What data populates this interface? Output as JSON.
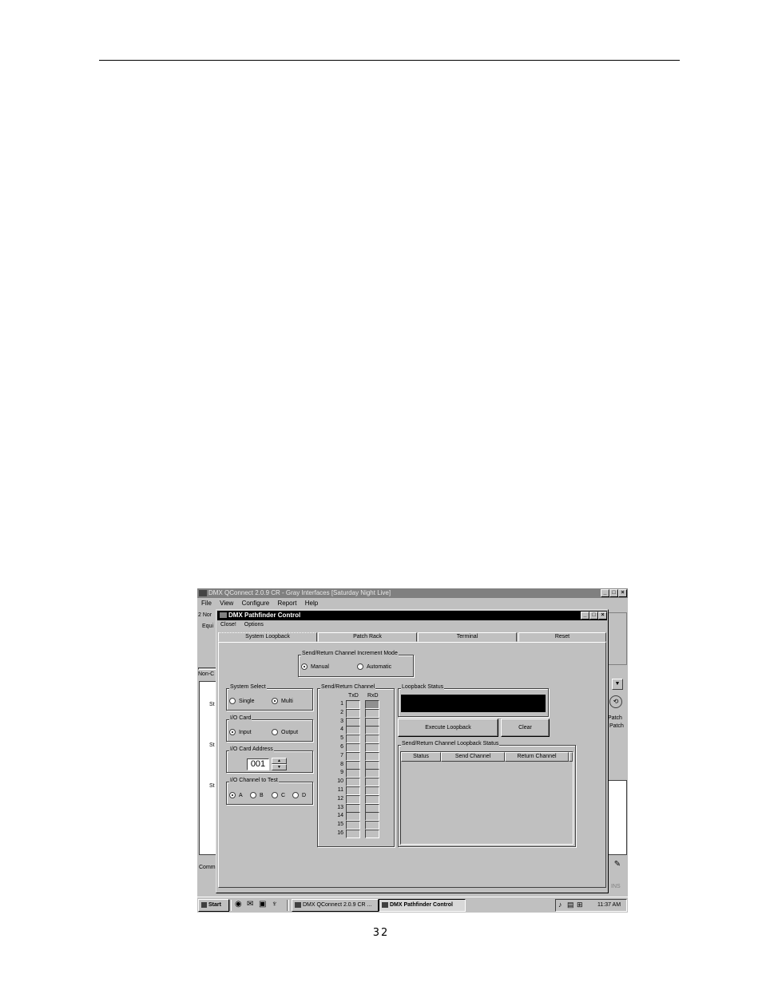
{
  "page": {
    "page_number": "32"
  },
  "main_window": {
    "title": "DMX QConnect 2.0.9 CR - Gray Interfaces [Saturday Night Live]",
    "menu": [
      "File",
      "View",
      "Configure",
      "Report",
      "Help"
    ],
    "left_fragments": [
      "2 Nor",
      "Equi",
      "Non-C",
      "St",
      "St",
      "St",
      "Comm"
    ],
    "right_fragments": [
      "Patch",
      "Patch"
    ],
    "status_fragment": "INS"
  },
  "dialog": {
    "title": "DMX Pathfinder Control",
    "menu": [
      "Close!",
      "Options"
    ],
    "tabs": [
      "System Loopback",
      "Patch Rack",
      "Terminal",
      "Reset"
    ],
    "increment_mode": {
      "label": "Send/Return Channel Increment Mode",
      "options": [
        "Manual",
        "Automatic"
      ],
      "selected": "Manual"
    },
    "system_select": {
      "label": "System Select",
      "options": [
        "Single",
        "Multi"
      ],
      "selected": "Multi"
    },
    "io_card": {
      "label": "I/O Card",
      "options": [
        "Input",
        "Output"
      ],
      "selected": "Input"
    },
    "io_card_address": {
      "label": "I/O Card Address",
      "value": "001"
    },
    "io_channel": {
      "label": "I/O Channel to Test",
      "options": [
        "A",
        "B",
        "C",
        "D"
      ],
      "selected": "A"
    },
    "channel_grid": {
      "label": "Send/Return Channel",
      "col_txd": "TxD",
      "col_rxd": "RxD",
      "rows": [
        "1",
        "2",
        "3",
        "4",
        "5",
        "6",
        "7",
        "8",
        "9",
        "10",
        "11",
        "12",
        "13",
        "14",
        "15",
        "16"
      ]
    },
    "loopback_status": {
      "label": "Loopback Status"
    },
    "execute_button": "Execute Loopback",
    "clear_button": "Clear",
    "status_table": {
      "label": "Send/Return Channel Loopback Status",
      "columns": [
        "Status",
        "Send Channel",
        "Return Channel"
      ]
    }
  },
  "taskbar": {
    "start": "Start",
    "tasks": [
      "DMX QConnect 2.0.9 CR ...",
      "DMX Pathfinder Control"
    ],
    "clock": "11:37 AM"
  }
}
